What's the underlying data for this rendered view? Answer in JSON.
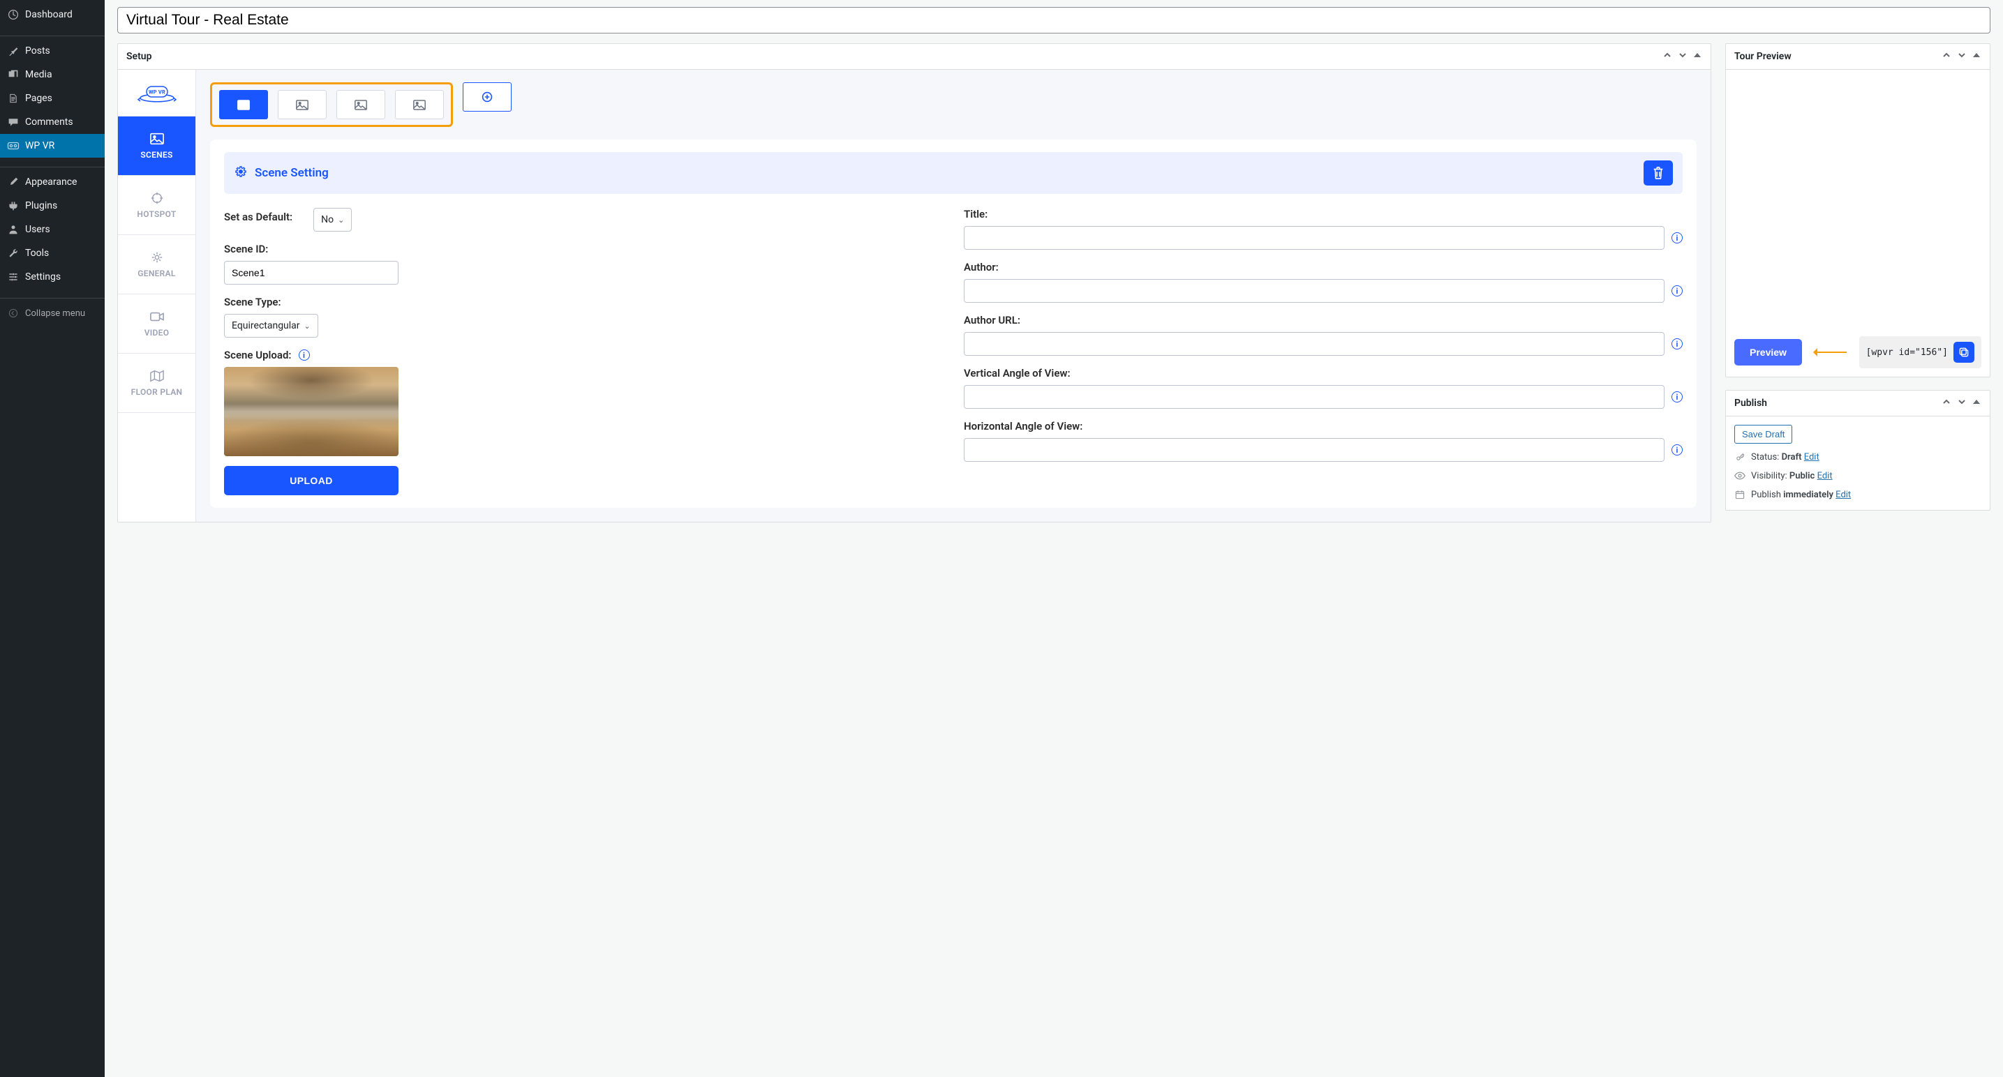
{
  "title": "Virtual Tour - Real Estate",
  "admin_menu": {
    "dashboard": "Dashboard",
    "posts": "Posts",
    "media": "Media",
    "pages": "Pages",
    "comments": "Comments",
    "wpvr": "WP VR",
    "appearance": "Appearance",
    "plugins": "Plugins",
    "users": "Users",
    "tools": "Tools",
    "settings": "Settings",
    "collapse": "Collapse menu"
  },
  "setup": {
    "header": "Setup",
    "tabs": {
      "scenes": "SCENES",
      "hotspot": "HOTSPOT",
      "general": "GENERAL",
      "video": "VIDEO",
      "floorplan": "FLOOR PLAN"
    },
    "scene_setting_title": "Scene Setting",
    "labels": {
      "set_default": "Set as Default:",
      "scene_id": "Scene ID:",
      "scene_type": "Scene Type:",
      "scene_upload": "Scene Upload:",
      "upload_btn": "UPLOAD",
      "title": "Title:",
      "author": "Author:",
      "author_url": "Author URL:",
      "vaov": "Vertical Angle of View:",
      "haov": "Horizontal Angle of View:"
    },
    "values": {
      "default": "No",
      "scene_id": "Scene1",
      "scene_type": "Equirectangular"
    }
  },
  "preview": {
    "header": "Tour Preview",
    "button": "Preview",
    "shortcode": "[wpvr id=\"156\"]"
  },
  "publish": {
    "header": "Publish",
    "save_draft": "Save Draft",
    "status_label": "Status:",
    "status_value": "Draft",
    "visibility_label": "Visibility:",
    "visibility_value": "Public",
    "schedule_label": "Publish",
    "schedule_value": "immediately",
    "edit": "Edit"
  }
}
